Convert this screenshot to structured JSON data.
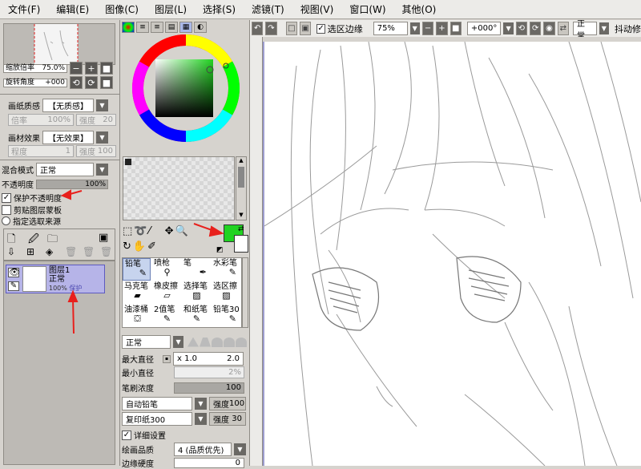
{
  "menu": [
    "文件(F)",
    "编辑(E)",
    "图像(C)",
    "图层(L)",
    "选择(S)",
    "滤镜(T)",
    "视图(V)",
    "窗口(W)",
    "其他(O)"
  ],
  "toolbar": {
    "selection_edge_label": "选区边缘",
    "zoom_value": "75%",
    "rotation_value": "+000°",
    "mode_value": "正常",
    "stabilizer_label": "抖动修"
  },
  "navigator": {
    "zoom_label": "缩放倍率",
    "zoom_value": "75.0%",
    "rotate_label": "旋转角度",
    "rotate_value": "+000"
  },
  "paper": {
    "texture_label": "画纸质感",
    "texture_value": "【无质感】",
    "scale_label": "倍率",
    "scale_value": "100%",
    "strength_label": "强度",
    "strength_value": "20",
    "effect_label": "画材效果",
    "effect_value": "【无效果】",
    "degree_label": "程度",
    "degree_value": "1",
    "effect_strength_label": "强度",
    "effect_strength_value": "100"
  },
  "layer": {
    "blend_label": "混合模式",
    "blend_value": "正常",
    "opacity_label": "不透明度",
    "opacity_value": "100%",
    "protect_opacity": "保护不透明度",
    "clip_group": "剪贴图层蒙板",
    "sel_source": "指定选取来源",
    "item_name": "图层1",
    "item_mode": "正常",
    "item_opacity": "100%",
    "item_protect": "保护"
  },
  "tools": [
    {
      "label": "铅笔",
      "icon": "pencil-icon"
    },
    {
      "label": "喷枪",
      "icon": "airbrush-icon"
    },
    {
      "label": "笔",
      "icon": "pen-icon"
    },
    {
      "label": "水彩笔",
      "icon": "watercolor-icon"
    },
    {
      "label": "马克笔",
      "icon": "marker-icon"
    },
    {
      "label": "橡皮擦",
      "icon": "eraser-icon"
    },
    {
      "label": "选择笔",
      "icon": "select-pen-icon"
    },
    {
      "label": "选区擦",
      "icon": "select-eraser-icon"
    },
    {
      "label": "油漆桶",
      "icon": "bucket-icon"
    },
    {
      "label": "2值笔",
      "icon": "binary-pen-icon"
    },
    {
      "label": "和纸笔",
      "icon": "washi-pen-icon"
    },
    {
      "label": "铅笔30",
      "icon": "pencil30-icon"
    }
  ],
  "brush": {
    "mode_value": "正常",
    "max_size_label": "最大直径",
    "max_size_mult": "x 1.0",
    "max_size_value": "2.0",
    "min_size_label": "最小直径",
    "min_size_value": "2%",
    "density_label": "笔刷浓度",
    "density_value": "100",
    "shape1_value": "自动铅笔",
    "shape1_strength_label": "强度",
    "shape1_strength_value": "100",
    "shape2_value": "复印纸300",
    "shape2_strength_label": "强度",
    "shape2_strength_value": "30",
    "detail_label": "详细设置",
    "quality_label": "绘画品质",
    "quality_value": "4 (品质优先)",
    "edge_label": "边缘硬度",
    "edge_value": "0"
  },
  "colors": {
    "primary": "#21d321",
    "secondary": "#ffffff",
    "annotation": "#e8201c",
    "layer_selected": "#b6b4e8"
  }
}
